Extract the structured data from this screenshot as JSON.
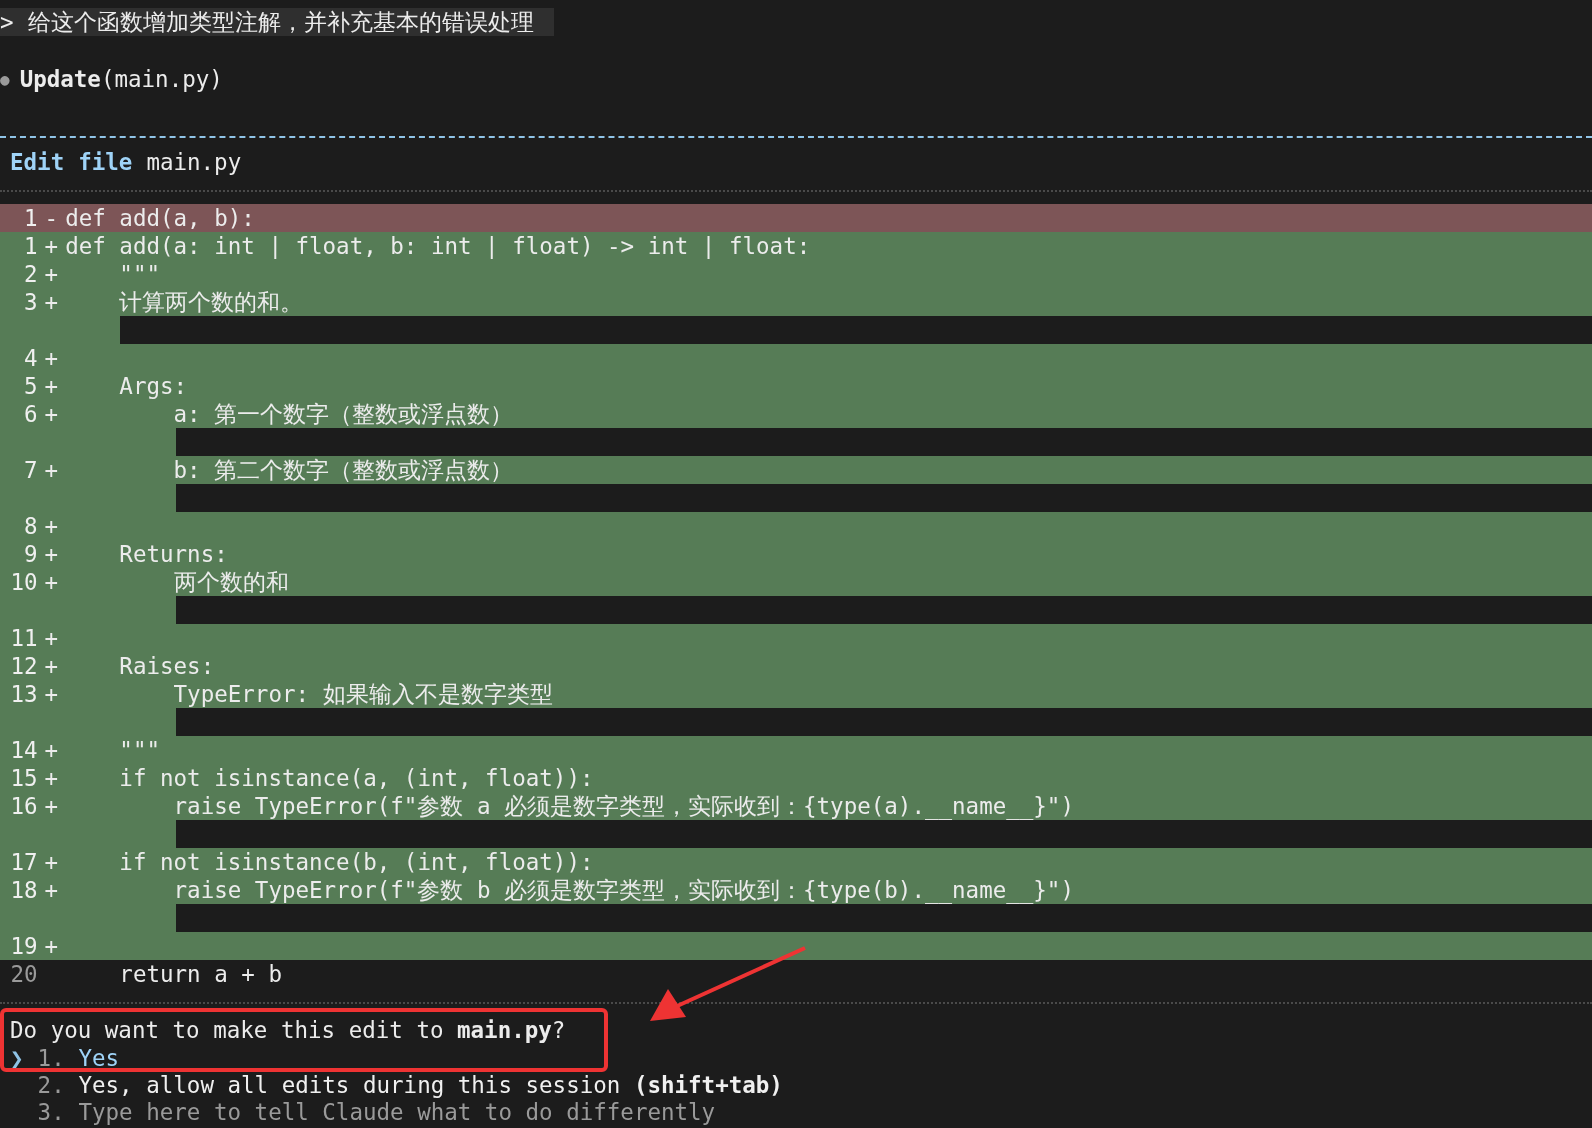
{
  "prompt": {
    "marker": ">",
    "text": "给这个函数增加类型注解，并补充基本的错误处理"
  },
  "tool_call": {
    "bullet": "●",
    "name": "Update",
    "argument": "(main.py)"
  },
  "edit_header": {
    "action": "Edit",
    "object": "file",
    "filename": "main.py"
  },
  "diff": [
    {
      "number": "1",
      "kind": "removed",
      "sign": "-",
      "code": "def add(a, b):",
      "strip": false
    },
    {
      "number": "1",
      "kind": "added",
      "sign": "+",
      "code": "def add(a: int | float, b: int | float) -> int | float:",
      "strip": false
    },
    {
      "number": "2",
      "kind": "added",
      "sign": "+",
      "code": "    \"\"\"",
      "strip": false
    },
    {
      "number": "3",
      "kind": "added",
      "sign": "+",
      "code": "    计算两个数的和。",
      "strip": true
    },
    {
      "number": "4",
      "kind": "added",
      "sign": "+",
      "strip": false
    },
    {
      "number": "5",
      "kind": "added",
      "sign": "+",
      "code": "    Args:",
      "strip": false
    },
    {
      "number": "6",
      "kind": "added",
      "sign": "+",
      "code": "        a: 第一个数字（整数或浮点数）",
      "strip": true
    },
    {
      "number": "7",
      "kind": "added",
      "sign": "+",
      "code": "        b: 第二个数字（整数或浮点数）",
      "strip": true
    },
    {
      "number": "8",
      "kind": "added",
      "sign": "+",
      "strip": false
    },
    {
      "number": "9",
      "kind": "added",
      "sign": "+",
      "code": "    Returns:",
      "strip": false
    },
    {
      "number": "10",
      "kind": "added",
      "sign": "+",
      "code": "        两个数的和",
      "strip": true
    },
    {
      "number": "11",
      "kind": "added",
      "sign": "+",
      "strip": false
    },
    {
      "number": "12",
      "kind": "added",
      "sign": "+",
      "code": "    Raises:",
      "strip": false
    },
    {
      "number": "13",
      "kind": "added",
      "sign": "+",
      "code": "        TypeError: 如果输入不是数字类型",
      "strip": true
    },
    {
      "number": "14",
      "kind": "added",
      "sign": "+",
      "code": "    \"\"\"",
      "strip": false
    },
    {
      "number": "15",
      "kind": "added",
      "sign": "+",
      "code": "    if not isinstance(a, (int, float)):",
      "strip": false
    },
    {
      "number": "16",
      "kind": "added",
      "sign": "+",
      "code": "        raise TypeError(f\"参数 a 必须是数字类型，实际收到：{type(a).__name__}\")",
      "strip": true
    },
    {
      "number": "17",
      "kind": "added",
      "sign": "+",
      "code": "    if not isinstance(b, (int, float)):",
      "strip": false
    },
    {
      "number": "18",
      "kind": "added",
      "sign": "+",
      "code": "        raise TypeError(f\"参数 b 必须是数字类型，实际收到：{type(b).__name__}\")",
      "strip": true
    },
    {
      "number": "19",
      "kind": "added",
      "sign": "+",
      "strip": false
    },
    {
      "number": "20",
      "kind": "context",
      "code": "    return a + b",
      "strip": false
    }
  ],
  "question": "Do you want to make this edit to **main.py**?",
  "options": [
    {
      "pointer": "❯",
      "number": "1.",
      "label": "Yes",
      "kind": "choice",
      "selected": true
    },
    {
      "number": "2.",
      "label": "Yes, allow all edits during this session **(shift+tab)**",
      "kind": "choice",
      "selected": false
    },
    {
      "number": "3.",
      "label": "Type here to tell Claude what to do differently",
      "kind": "input",
      "selected": false
    }
  ]
}
